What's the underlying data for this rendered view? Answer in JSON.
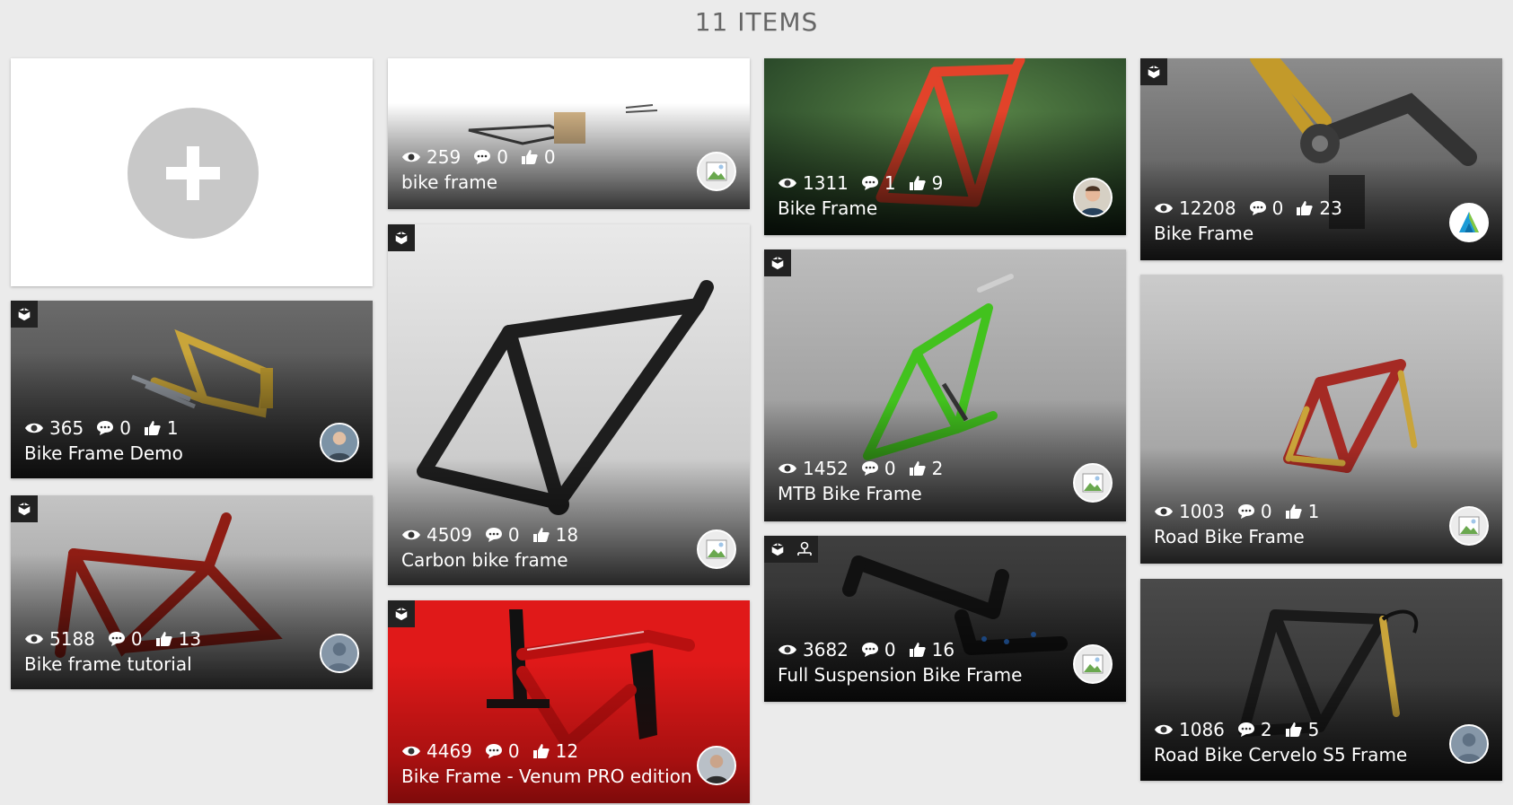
{
  "header": {
    "title": "11 ITEMS"
  },
  "add_card": {
    "label": ""
  },
  "cards": [
    {
      "id": "c1",
      "title": "bike frame",
      "views": "259",
      "comments": "0",
      "likes": "0",
      "badges": [],
      "avatar": "placeholder-image-icon"
    },
    {
      "id": "c2",
      "title": "Bike Frame",
      "views": "1311",
      "comments": "1",
      "likes": "9",
      "badges": [],
      "avatar": "user-photo"
    },
    {
      "id": "c3",
      "title": "Bike Frame",
      "views": "12208",
      "comments": "0",
      "likes": "23",
      "badges": [
        "cube-icon"
      ],
      "avatar": "autodesk-logo"
    },
    {
      "id": "c4",
      "title": "Bike Frame Demo",
      "views": "365",
      "comments": "0",
      "likes": "1",
      "badges": [
        "cube-icon"
      ],
      "avatar": "user-photo"
    },
    {
      "id": "c5",
      "title": "Carbon bike frame",
      "views": "4509",
      "comments": "0",
      "likes": "18",
      "badges": [
        "cube-icon"
      ],
      "avatar": "placeholder-image-icon"
    },
    {
      "id": "c6",
      "title": "MTB Bike Frame",
      "views": "1452",
      "comments": "0",
      "likes": "2",
      "badges": [
        "cube-icon"
      ],
      "avatar": "placeholder-image-icon"
    },
    {
      "id": "c7",
      "title": "Road Bike Frame",
      "views": "1003",
      "comments": "0",
      "likes": "1",
      "badges": [],
      "avatar": "placeholder-image-icon"
    },
    {
      "id": "c8",
      "title": "Bike frame tutorial",
      "views": "5188",
      "comments": "0",
      "likes": "13",
      "badges": [
        "cube-icon"
      ],
      "avatar": "default-user-icon"
    },
    {
      "id": "c9",
      "title": "Full Suspension Bike Frame",
      "views": "3682",
      "comments": "0",
      "likes": "16",
      "badges": [
        "cube-icon",
        "assembly-icon"
      ],
      "avatar": "placeholder-image-icon"
    },
    {
      "id": "c10",
      "title": "Bike Frame - Venum PRO edition",
      "views": "4469",
      "comments": "0",
      "likes": "12",
      "badges": [
        "cube-icon"
      ],
      "avatar": "user-photo"
    },
    {
      "id": "c11",
      "title": "Road Bike Cervelo S5 Frame",
      "views": "1086",
      "comments": "2",
      "likes": "5",
      "badges": [],
      "avatar": "default-user-icon"
    }
  ],
  "colors": {
    "page_bg": "#ebebeb",
    "accent_red": "#e01919",
    "text_white": "#ffffff"
  }
}
